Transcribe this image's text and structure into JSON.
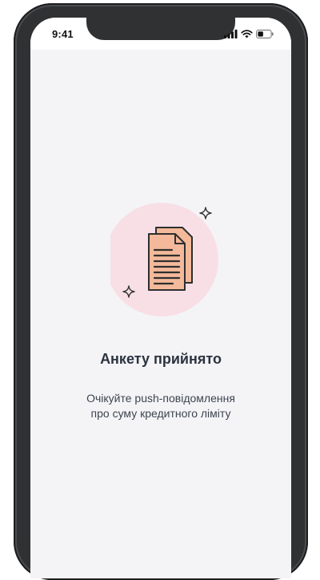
{
  "status_bar": {
    "time": "9:41",
    "icons": [
      "cellular-signal-icon",
      "wifi-icon",
      "battery-icon"
    ]
  },
  "main": {
    "illustration_icon": "documents-icon",
    "title": "Анкету прийнято",
    "subtitle_line1": "Очікуйте push-повідомлення",
    "subtitle_line2": "про суму кредитного ліміту"
  },
  "colors": {
    "accent_circle": "#f8dfe6",
    "document_fill": "#f3b99a",
    "document_stroke": "#2f2f2f",
    "frame": "#2f3133"
  }
}
